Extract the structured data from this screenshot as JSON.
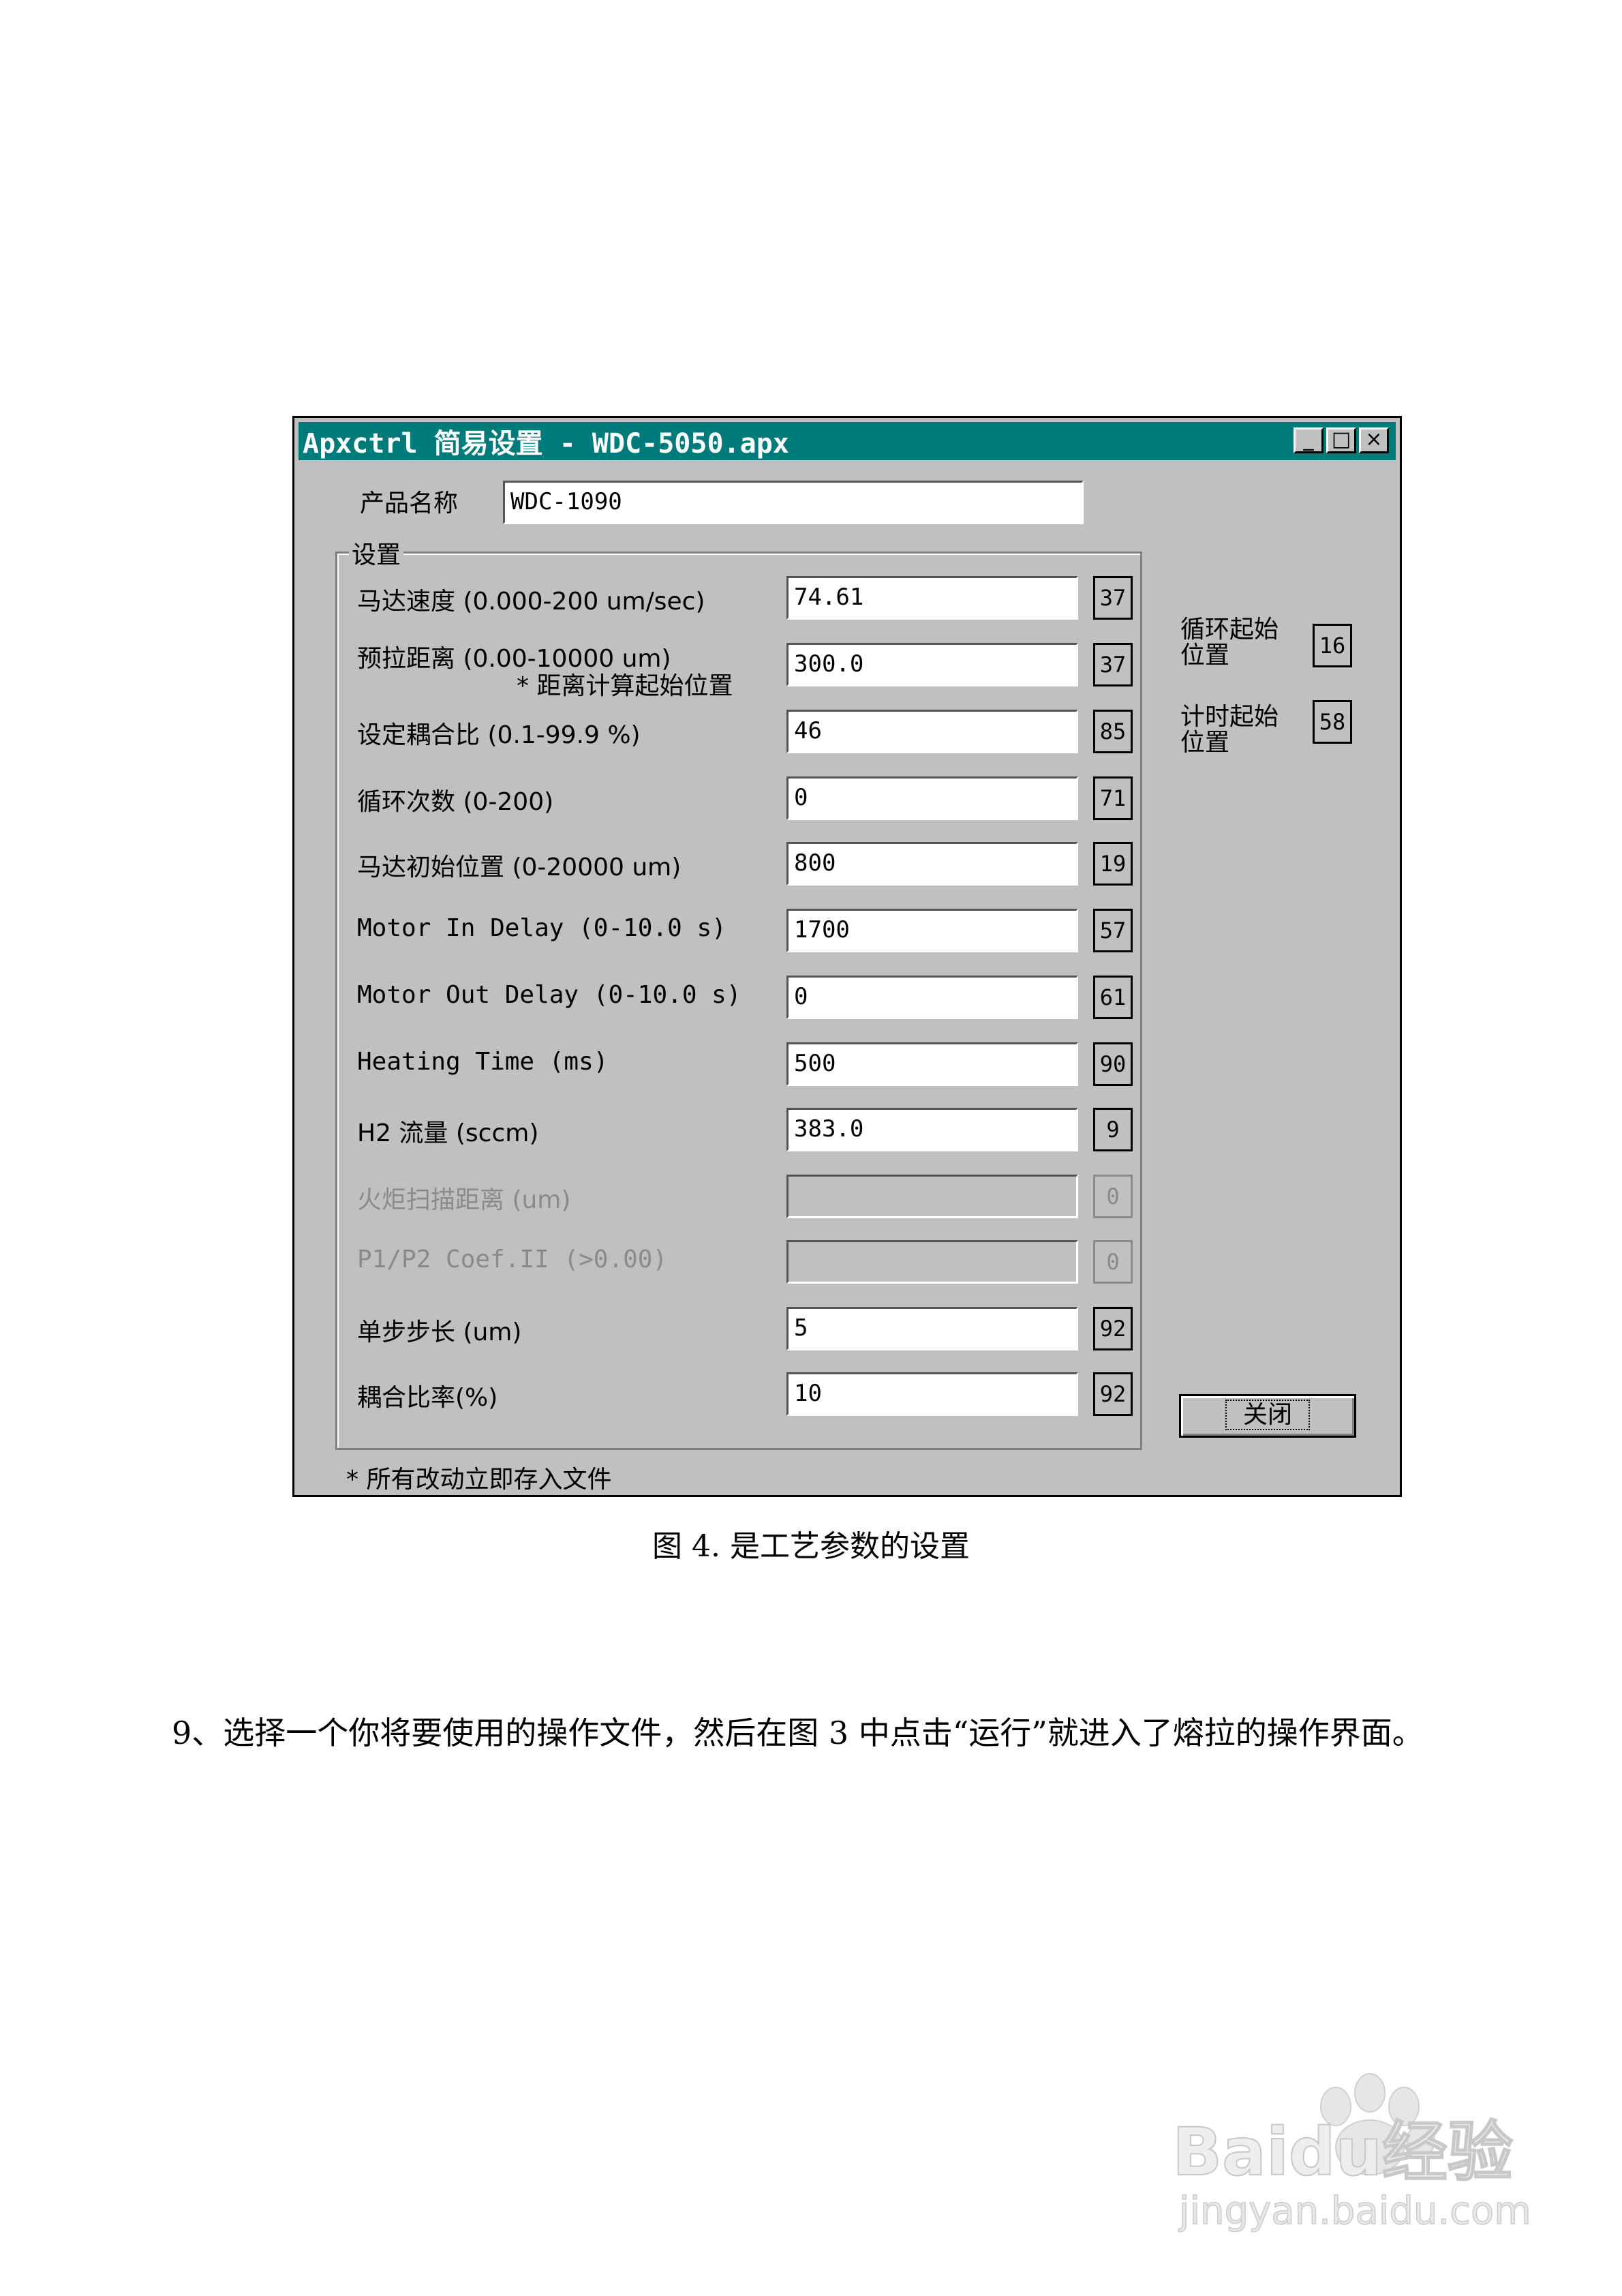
{
  "window": {
    "title": "Apxctrl 简易设置 - WDC-5050.apx",
    "buttons": [
      "_",
      "□",
      "×"
    ],
    "product_label": "产品名称",
    "product_value": "WDC-1090",
    "group_label": "设置",
    "rows": [
      {
        "label": "马达速度 (0.000-200 um/sec)",
        "value": "74.61",
        "num": "37",
        "disabled": false
      },
      {
        "label": "预拉距离 (0.00-10000 um)",
        "sublabel": "* 距离计算起始位置",
        "value": "300.0",
        "num": "37",
        "disabled": false
      },
      {
        "label": "设定耦合比 (0.1-99.9 %)",
        "value": "46",
        "num": "85",
        "disabled": false
      },
      {
        "label": "循环次数 (0-200)",
        "value": "0",
        "num": "71",
        "disabled": false
      },
      {
        "label": "马达初始位置 (0-20000 um)",
        "value": "800",
        "num": "19",
        "disabled": false
      },
      {
        "label": "Motor In Delay (0-10.0 s)",
        "value": "1700",
        "num": "57",
        "disabled": false
      },
      {
        "label": "Motor Out Delay (0-10.0 s)",
        "value": "0",
        "num": "61",
        "disabled": false
      },
      {
        "label": "Heating Time (ms)",
        "value": "500",
        "num": "90",
        "disabled": false
      },
      {
        "label": "H2 流量 (sccm)",
        "value": "383.0",
        "num": "9",
        "disabled": false
      },
      {
        "label": "火炬扫描距离 (um)",
        "value": "",
        "num": "0",
        "disabled": true
      },
      {
        "label": "P1/P2 Coef.II (>0.00)",
        "value": "",
        "num": "0",
        "disabled": true
      },
      {
        "label": "单步步长 (um)",
        "value": "5",
        "num": "92",
        "disabled": false
      },
      {
        "label": "耦合比率(%)",
        "value": "10",
        "num": "92",
        "disabled": false
      }
    ],
    "side": [
      {
        "label1": "循环起始",
        "label2": "位置",
        "num": "16"
      },
      {
        "label1": "计时起始",
        "label2": "位置",
        "num": "58"
      }
    ],
    "close_label": "关闭",
    "footer_note": "* 所有改动立即存入文件"
  },
  "caption": "图 4. 是工艺参数的设置",
  "paragraph": "9、选择一个你将要使用的操作文件，然后在图 3 中点击“运行”就进入了熔拉的操作界面。",
  "watermark": {
    "brand": "Baidu经验",
    "url": "jingyan.baidu.com"
  }
}
